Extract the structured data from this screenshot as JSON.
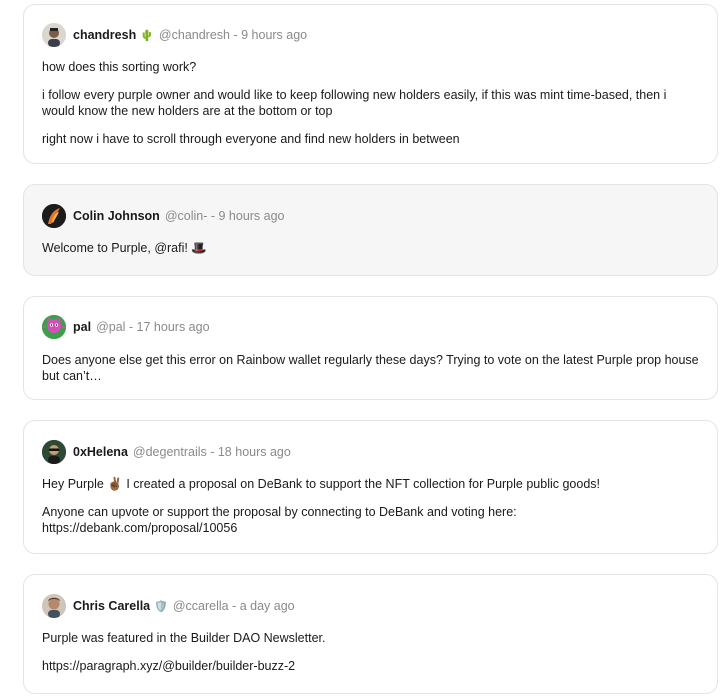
{
  "posts": [
    {
      "author": "chandresh",
      "emoji": "🌵",
      "handle": "@chandresh",
      "time": "9 hours ago",
      "paragraphs": [
        "how does this sorting work?",
        "i follow every purple owner and would like to keep following new holders easily, if this was mint time-based, then i would know the new holders are at the bottom or top",
        "right now i have to scroll through everyone and find new holders in between"
      ]
    },
    {
      "author": "Colin Johnson",
      "handle": "@colin-",
      "time": "9 hours ago",
      "paragraphs": [
        "Welcome to Purple, @rafi! 🎩"
      ]
    },
    {
      "author": "pal",
      "handle": "@pal",
      "time": "17 hours ago",
      "paragraphs": [
        "Does anyone else get this error on Rainbow wallet regularly these days? Trying to vote on the latest Purple prop house but can’t…"
      ]
    },
    {
      "author": "0xHelena",
      "handle": "@degentrails",
      "time": "18 hours ago",
      "paragraphs": [
        "Hey Purple ✌🏾 I created a proposal on  DeBank to support the NFT collection for Purple public goods!",
        "Anyone can upvote or support the proposal by connecting to DeBank and voting here:",
        "https://debank.com/proposal/10056"
      ]
    },
    {
      "author": "Chris Carella",
      "emoji": "🛡️",
      "handle": "@ccarella",
      "time": "a day ago",
      "paragraphs": [
        "Purple was featured in the Builder DAO Newsletter.",
        "https://paragraph.xyz/@builder/builder-buzz-2"
      ]
    }
  ],
  "separator": " - ",
  "colors": {
    "border": "#e4e4e4",
    "hover_bg": "#f6f6f6",
    "meta_text": "#8a8a8a",
    "text": "#1a1a1a"
  }
}
